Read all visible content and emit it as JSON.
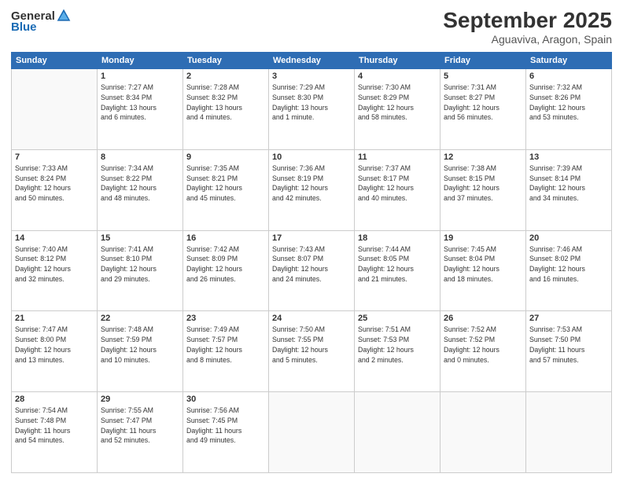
{
  "logo": {
    "general": "General",
    "blue": "Blue"
  },
  "header": {
    "month": "September 2025",
    "location": "Aguaviva, Aragon, Spain"
  },
  "weekdays": [
    "Sunday",
    "Monday",
    "Tuesday",
    "Wednesday",
    "Thursday",
    "Friday",
    "Saturday"
  ],
  "weeks": [
    [
      {
        "day": "",
        "info": ""
      },
      {
        "day": "1",
        "info": "Sunrise: 7:27 AM\nSunset: 8:34 PM\nDaylight: 13 hours\nand 6 minutes."
      },
      {
        "day": "2",
        "info": "Sunrise: 7:28 AM\nSunset: 8:32 PM\nDaylight: 13 hours\nand 4 minutes."
      },
      {
        "day": "3",
        "info": "Sunrise: 7:29 AM\nSunset: 8:30 PM\nDaylight: 13 hours\nand 1 minute."
      },
      {
        "day": "4",
        "info": "Sunrise: 7:30 AM\nSunset: 8:29 PM\nDaylight: 12 hours\nand 58 minutes."
      },
      {
        "day": "5",
        "info": "Sunrise: 7:31 AM\nSunset: 8:27 PM\nDaylight: 12 hours\nand 56 minutes."
      },
      {
        "day": "6",
        "info": "Sunrise: 7:32 AM\nSunset: 8:26 PM\nDaylight: 12 hours\nand 53 minutes."
      }
    ],
    [
      {
        "day": "7",
        "info": "Sunrise: 7:33 AM\nSunset: 8:24 PM\nDaylight: 12 hours\nand 50 minutes."
      },
      {
        "day": "8",
        "info": "Sunrise: 7:34 AM\nSunset: 8:22 PM\nDaylight: 12 hours\nand 48 minutes."
      },
      {
        "day": "9",
        "info": "Sunrise: 7:35 AM\nSunset: 8:21 PM\nDaylight: 12 hours\nand 45 minutes."
      },
      {
        "day": "10",
        "info": "Sunrise: 7:36 AM\nSunset: 8:19 PM\nDaylight: 12 hours\nand 42 minutes."
      },
      {
        "day": "11",
        "info": "Sunrise: 7:37 AM\nSunset: 8:17 PM\nDaylight: 12 hours\nand 40 minutes."
      },
      {
        "day": "12",
        "info": "Sunrise: 7:38 AM\nSunset: 8:15 PM\nDaylight: 12 hours\nand 37 minutes."
      },
      {
        "day": "13",
        "info": "Sunrise: 7:39 AM\nSunset: 8:14 PM\nDaylight: 12 hours\nand 34 minutes."
      }
    ],
    [
      {
        "day": "14",
        "info": "Sunrise: 7:40 AM\nSunset: 8:12 PM\nDaylight: 12 hours\nand 32 minutes."
      },
      {
        "day": "15",
        "info": "Sunrise: 7:41 AM\nSunset: 8:10 PM\nDaylight: 12 hours\nand 29 minutes."
      },
      {
        "day": "16",
        "info": "Sunrise: 7:42 AM\nSunset: 8:09 PM\nDaylight: 12 hours\nand 26 minutes."
      },
      {
        "day": "17",
        "info": "Sunrise: 7:43 AM\nSunset: 8:07 PM\nDaylight: 12 hours\nand 24 minutes."
      },
      {
        "day": "18",
        "info": "Sunrise: 7:44 AM\nSunset: 8:05 PM\nDaylight: 12 hours\nand 21 minutes."
      },
      {
        "day": "19",
        "info": "Sunrise: 7:45 AM\nSunset: 8:04 PM\nDaylight: 12 hours\nand 18 minutes."
      },
      {
        "day": "20",
        "info": "Sunrise: 7:46 AM\nSunset: 8:02 PM\nDaylight: 12 hours\nand 16 minutes."
      }
    ],
    [
      {
        "day": "21",
        "info": "Sunrise: 7:47 AM\nSunset: 8:00 PM\nDaylight: 12 hours\nand 13 minutes."
      },
      {
        "day": "22",
        "info": "Sunrise: 7:48 AM\nSunset: 7:59 PM\nDaylight: 12 hours\nand 10 minutes."
      },
      {
        "day": "23",
        "info": "Sunrise: 7:49 AM\nSunset: 7:57 PM\nDaylight: 12 hours\nand 8 minutes."
      },
      {
        "day": "24",
        "info": "Sunrise: 7:50 AM\nSunset: 7:55 PM\nDaylight: 12 hours\nand 5 minutes."
      },
      {
        "day": "25",
        "info": "Sunrise: 7:51 AM\nSunset: 7:53 PM\nDaylight: 12 hours\nand 2 minutes."
      },
      {
        "day": "26",
        "info": "Sunrise: 7:52 AM\nSunset: 7:52 PM\nDaylight: 12 hours\nand 0 minutes."
      },
      {
        "day": "27",
        "info": "Sunrise: 7:53 AM\nSunset: 7:50 PM\nDaylight: 11 hours\nand 57 minutes."
      }
    ],
    [
      {
        "day": "28",
        "info": "Sunrise: 7:54 AM\nSunset: 7:48 PM\nDaylight: 11 hours\nand 54 minutes."
      },
      {
        "day": "29",
        "info": "Sunrise: 7:55 AM\nSunset: 7:47 PM\nDaylight: 11 hours\nand 52 minutes."
      },
      {
        "day": "30",
        "info": "Sunrise: 7:56 AM\nSunset: 7:45 PM\nDaylight: 11 hours\nand 49 minutes."
      },
      {
        "day": "",
        "info": ""
      },
      {
        "day": "",
        "info": ""
      },
      {
        "day": "",
        "info": ""
      },
      {
        "day": "",
        "info": ""
      }
    ]
  ]
}
